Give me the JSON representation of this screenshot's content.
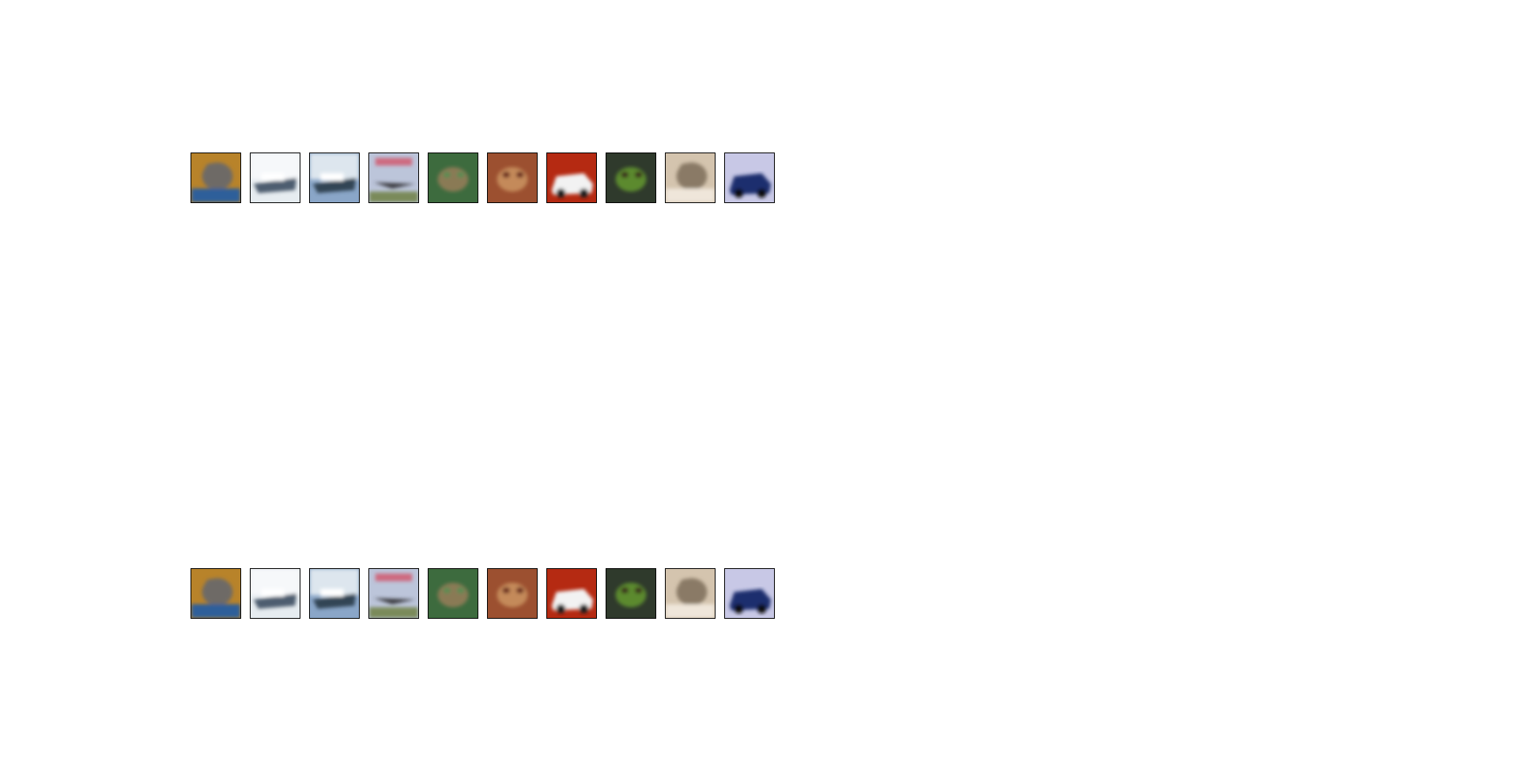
{
  "figure": {
    "rows": [
      {
        "name": "top-row",
        "images": [
          {
            "subject": "cat",
            "palette": [
              "#b8832a",
              "#6e6a66",
              "#2f5f9a"
            ]
          },
          {
            "subject": "ship",
            "palette": [
              "#e6ecf0",
              "#f6f8fa",
              "#4d5d70"
            ]
          },
          {
            "subject": "ship",
            "palette": [
              "#8aa6c8",
              "#dde6ee",
              "#334455"
            ]
          },
          {
            "subject": "airplane",
            "palette": [
              "#bcc5da",
              "#3a3a40",
              "#7a8a5a"
            ]
          },
          {
            "subject": "frog",
            "palette": [
              "#3d6b3e",
              "#8a7a55",
              "#5a8c52"
            ]
          },
          {
            "subject": "frog",
            "palette": [
              "#9c5030",
              "#c48a5a",
              "#6a2a1a"
            ]
          },
          {
            "subject": "automobile",
            "palette": [
              "#b52a12",
              "#f2f2f2",
              "#1a1a1a"
            ]
          },
          {
            "subject": "frog",
            "palette": [
              "#2f3a2c",
              "#5b8a2e",
              "#3a2a1a"
            ]
          },
          {
            "subject": "cat",
            "palette": [
              "#d4c4ae",
              "#8a7a66",
              "#efe6da"
            ]
          },
          {
            "subject": "automobile",
            "palette": [
              "#c8c8e6",
              "#1f2d6e",
              "#101010"
            ]
          }
        ]
      },
      {
        "name": "bottom-row",
        "images": [
          {
            "subject": "cat",
            "palette": [
              "#b8832a",
              "#6e6a66",
              "#2f5f9a"
            ]
          },
          {
            "subject": "ship",
            "palette": [
              "#e6ecf0",
              "#f6f8fa",
              "#4d5d70"
            ]
          },
          {
            "subject": "ship",
            "palette": [
              "#8aa6c8",
              "#dde6ee",
              "#334455"
            ]
          },
          {
            "subject": "airplane",
            "palette": [
              "#bcc5da",
              "#3a3a40",
              "#7a8a5a"
            ]
          },
          {
            "subject": "frog",
            "palette": [
              "#3d6b3e",
              "#8a7a55",
              "#5a8c52"
            ]
          },
          {
            "subject": "frog",
            "palette": [
              "#9c5030",
              "#c48a5a",
              "#6a2a1a"
            ]
          },
          {
            "subject": "automobile",
            "palette": [
              "#b52a12",
              "#f2f2f2",
              "#1a1a1a"
            ]
          },
          {
            "subject": "frog",
            "palette": [
              "#2f3a2c",
              "#5b8a2e",
              "#3a2a1a"
            ]
          },
          {
            "subject": "cat",
            "palette": [
              "#d4c4ae",
              "#8a7a66",
              "#efe6da"
            ]
          },
          {
            "subject": "automobile",
            "palette": [
              "#c8c8e6",
              "#1f2d6e",
              "#101010"
            ]
          }
        ]
      }
    ]
  }
}
